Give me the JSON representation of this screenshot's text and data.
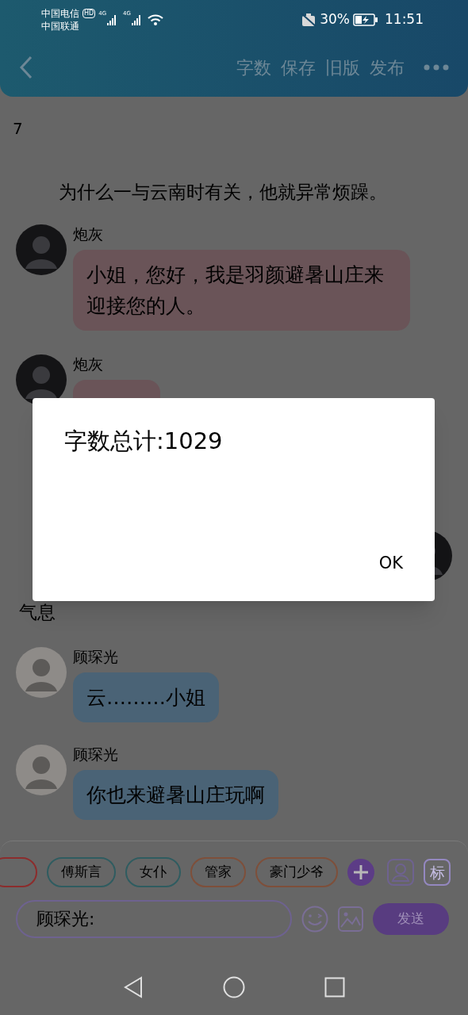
{
  "status_bar": {
    "carrier_1": "中国电信",
    "hd_badge": "HD",
    "carrier_2": "中国联通",
    "network_1": "4G",
    "network_2": "4G",
    "battery": "30%",
    "time": "11:51"
  },
  "toolbar": {
    "actions": [
      "字数",
      "保存",
      "旧版",
      "发布"
    ]
  },
  "chapter_number": "7",
  "chat": [
    {
      "kind": "narration",
      "lines": [
        "为什么一与云南时有关，他就异常烦躁。"
      ],
      "indent": true
    },
    {
      "kind": "message",
      "name": "炮灰",
      "text": "小姐，您好，我是羽颜避暑山庄来迎接您的人。",
      "color": "#6a5458",
      "avatar_light": false
    },
    {
      "kind": "message",
      "name": "炮灰",
      "color": "#6a5458",
      "avatar_light": false
    },
    {
      "kind": "own_message",
      "avatar_light": false
    },
    {
      "kind": "narration",
      "lines": [
        "气息"
      ],
      "indent": false
    },
    {
      "kind": "message",
      "name": "顾琛光",
      "text": "云………小姐",
      "color": "#4a6376",
      "avatar_light": true
    },
    {
      "kind": "message",
      "name": "顾琛光",
      "text": "你也来避暑山庄玩啊",
      "color": "#4a6376",
      "avatar_light": true
    }
  ],
  "role_chips": [
    {
      "color": "#8c2c2c"
    },
    {
      "label": "傅斯言",
      "color": "#2f5c60"
    },
    {
      "label": "女仆",
      "color": "#2f5c60"
    },
    {
      "label": "管家",
      "color": "#7e4f3a"
    },
    {
      "label": "豪门少爷",
      "color": "#7e4f3a"
    }
  ],
  "tag_button": "标",
  "composer": {
    "value": "顾琛光:",
    "send": "发送"
  },
  "dialog": {
    "message": "字数总计:1029",
    "button": "OK"
  }
}
